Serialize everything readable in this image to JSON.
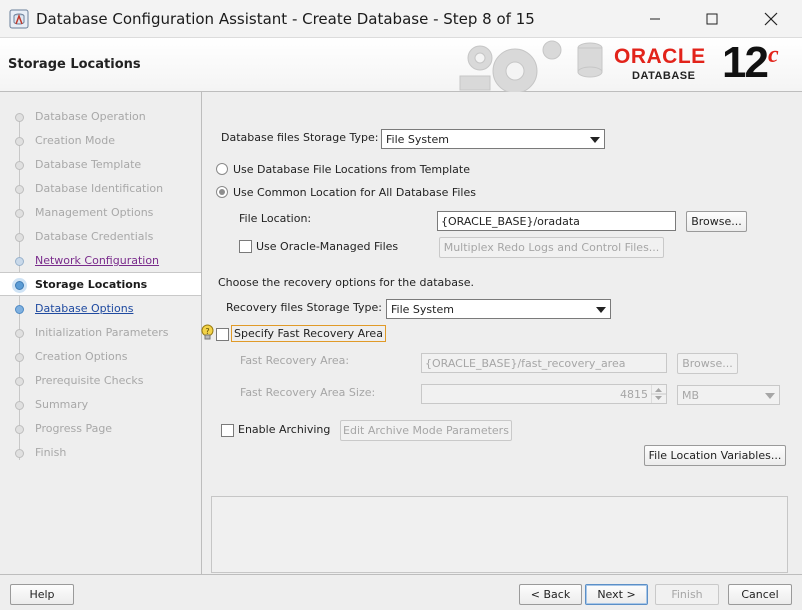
{
  "window": {
    "title": "Database Configuration Assistant - Create Database - Step 8 of 15",
    "minimize": "minimize",
    "maximize": "maximize",
    "close": "close"
  },
  "banner": {
    "title": "Storage Locations",
    "brand_oracle": "ORACLE",
    "brand_database": "DATABASE",
    "brand_version": "12",
    "brand_version_sup": "c"
  },
  "nav": {
    "items": [
      {
        "label": "Database Operation",
        "state": "disabled"
      },
      {
        "label": "Creation Mode",
        "state": "disabled"
      },
      {
        "label": "Database Template",
        "state": "disabled"
      },
      {
        "label": "Database Identification",
        "state": "disabled"
      },
      {
        "label": "Management Options",
        "state": "disabled"
      },
      {
        "label": "Database Credentials",
        "state": "disabled"
      },
      {
        "label": "Network Configuration",
        "state": "visited"
      },
      {
        "label": "Storage Locations",
        "state": "active"
      },
      {
        "label": "Database Options",
        "state": "link"
      },
      {
        "label": "Initialization Parameters",
        "state": "disabled"
      },
      {
        "label": "Creation Options",
        "state": "disabled"
      },
      {
        "label": "Prerequisite Checks",
        "state": "disabled"
      },
      {
        "label": "Summary",
        "state": "disabled"
      },
      {
        "label": "Progress Page",
        "state": "disabled"
      },
      {
        "label": "Finish",
        "state": "disabled"
      }
    ]
  },
  "form": {
    "db_storage_type_label": "Database files Storage Type:",
    "db_storage_type_value": "File System",
    "radio_template_label": "Use Database File Locations from Template",
    "radio_common_label": "Use Common Location for All Database Files",
    "file_location_label": "File Location:",
    "file_location_value": "{ORACLE_BASE}/oradata",
    "browse_label": "Browse...",
    "omf_label": "Use Oracle-Managed Files",
    "multiplex_label": "Multiplex Redo Logs and Control Files...",
    "recovery_heading": "Choose the recovery options for the database.",
    "recovery_storage_label": "Recovery files Storage Type:",
    "recovery_storage_value": "File System",
    "specify_fra_label": "Specify Fast Recovery Area",
    "fra_label": "Fast Recovery Area:",
    "fra_value": "{ORACLE_BASE}/fast_recovery_area",
    "fra_browse_label": "Browse...",
    "fra_size_label": "Fast Recovery Area Size:",
    "fra_size_value": "4815",
    "fra_size_unit": "MB",
    "enable_archiving_label": "Enable Archiving",
    "edit_archive_label": "Edit Archive Mode Parameters",
    "file_location_vars_label": "File Location Variables..."
  },
  "footer": {
    "help": "Help",
    "back": "< Back",
    "next": "Next >",
    "finish": "Finish",
    "cancel": "Cancel"
  },
  "colors": {
    "oracle_red": "#e2231a",
    "active_blue": "#1f4aa0",
    "visited_purple": "#7a2c8c"
  }
}
